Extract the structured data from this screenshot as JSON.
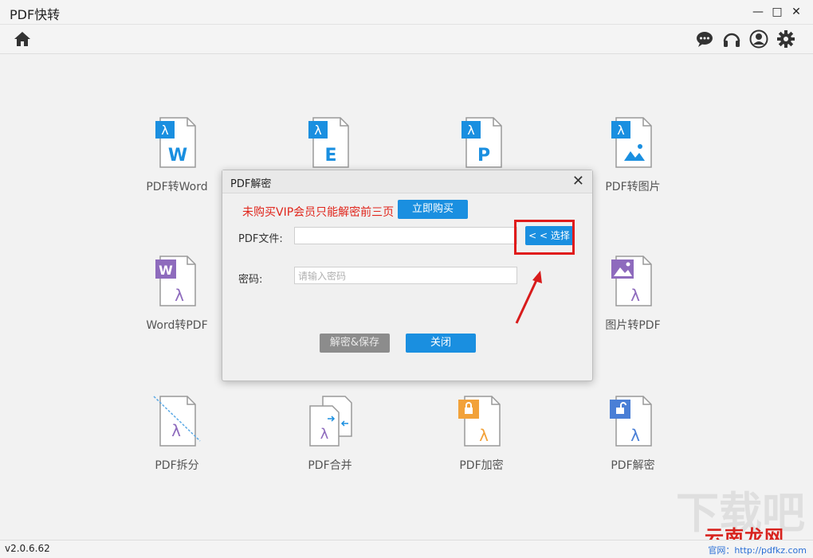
{
  "app": {
    "title": "PDF快转"
  },
  "tools": [
    {
      "name": "pdf-to-word",
      "label": "PDF转Word",
      "badge": "W"
    },
    {
      "name": "pdf-to-excel",
      "label": "",
      "badge": "E"
    },
    {
      "name": "pdf-to-ppt",
      "label": "",
      "badge": "P"
    },
    {
      "name": "pdf-to-image",
      "label": "PDF转图片",
      "badge": ""
    },
    {
      "name": "word-to-pdf",
      "label": "Word转PDF",
      "badge": "W"
    },
    {
      "name": "image-to-pdf",
      "label": "图片转PDF",
      "badge": ""
    },
    {
      "name": "pdf-split",
      "label": "PDF拆分",
      "badge": ""
    },
    {
      "name": "pdf-merge",
      "label": "PDF合并",
      "badge": ""
    },
    {
      "name": "pdf-encrypt",
      "label": "PDF加密",
      "badge": ""
    },
    {
      "name": "pdf-decrypt",
      "label": "PDF解密",
      "badge": ""
    }
  ],
  "dialog": {
    "title": "PDF解密",
    "warning": "未购买VIP会员只能解密前三页",
    "buy_label": "立即购买",
    "file_label": "PDF文件:",
    "file_value": "",
    "select_label": "< < 选择",
    "password_label": "密码:",
    "password_placeholder": "请输入密码",
    "decrypt_label": "解密&保存",
    "close_label": "关闭"
  },
  "status": {
    "version": "v2.0.6.62",
    "site": "官网：http://pdfkz.com"
  },
  "watermark": {
    "text": "云南龙网",
    "bg_text": "下载吧"
  },
  "colors": {
    "accent": "#1a8fe0",
    "warning": "#e0251b",
    "pdf_blue": "#1a8fe0",
    "purple": "#8e6bbd",
    "orange": "#f2a23a"
  }
}
